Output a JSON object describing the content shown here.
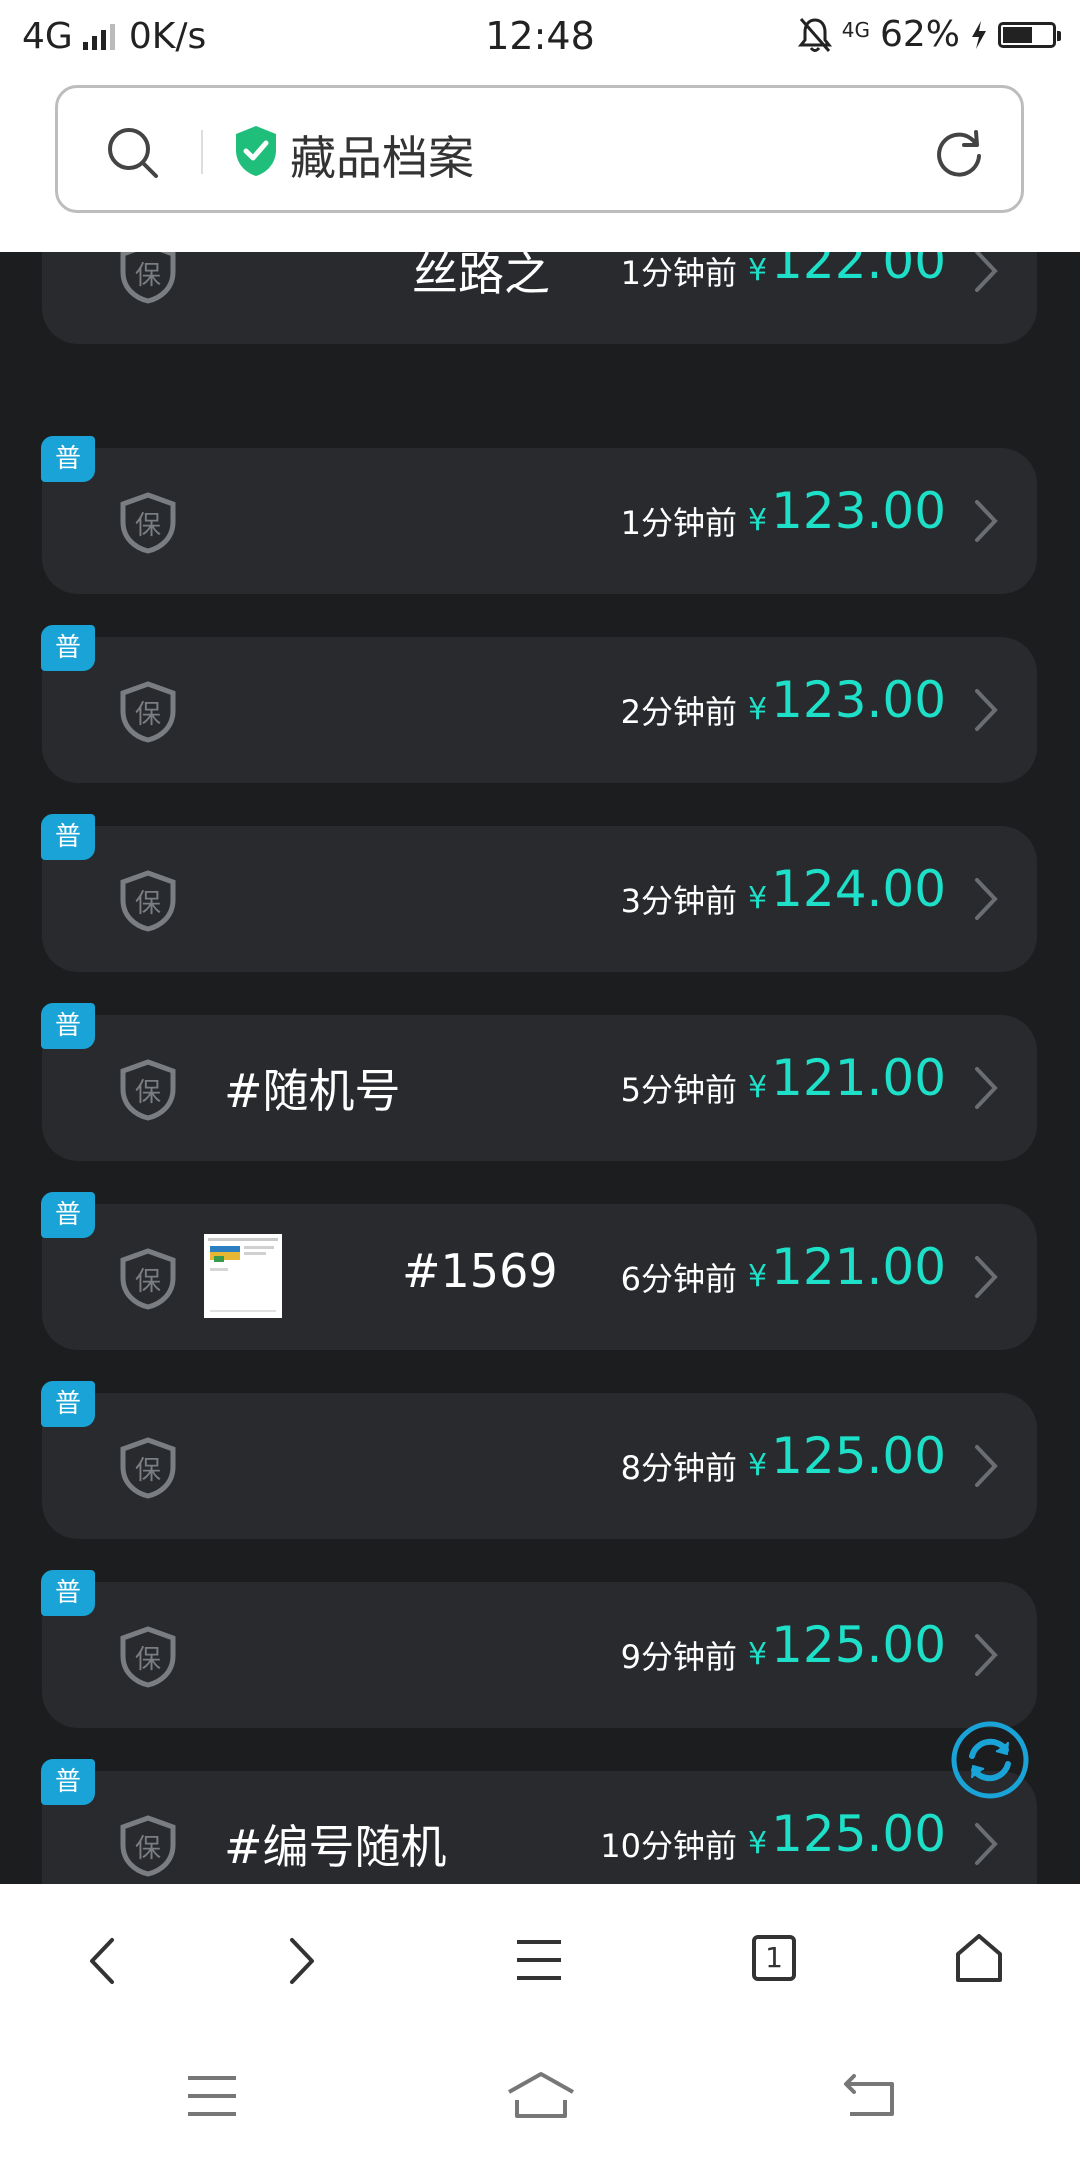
{
  "status_bar": {
    "network": "4G",
    "speed": "0K/s",
    "time": "12:48",
    "secondary_network": "4G",
    "battery": "62%",
    "battery_level": 0.62
  },
  "search_bar": {
    "title": "藏品档案"
  },
  "listings": [
    {
      "badge": "",
      "name": "丝路之",
      "time": "1分钟前",
      "currency": "¥",
      "price": "122.00"
    },
    {
      "badge": "普",
      "name": "",
      "time": "1分钟前",
      "currency": "¥",
      "price": "123.00"
    },
    {
      "badge": "普",
      "name": "",
      "time": "2分钟前",
      "currency": "¥",
      "price": "123.00"
    },
    {
      "badge": "普",
      "name": "",
      "time": "3分钟前",
      "currency": "¥",
      "price": "124.00"
    },
    {
      "badge": "普",
      "name": "#随机号",
      "time": "5分钟前",
      "currency": "¥",
      "price": "121.00"
    },
    {
      "badge": "普",
      "name": "#1569",
      "time": "6分钟前",
      "currency": "¥",
      "price": "121.00"
    },
    {
      "badge": "普",
      "name": "",
      "time": "8分钟前",
      "currency": "¥",
      "price": "125.00"
    },
    {
      "badge": "普",
      "name": "",
      "time": "9分钟前",
      "currency": "¥",
      "price": "125.00"
    },
    {
      "badge": "普",
      "name": "#编号随机",
      "time": "10分钟前",
      "currency": "¥",
      "price": "125.00"
    }
  ],
  "shield_char": "保",
  "tab_count": "1",
  "colors": {
    "accent": "#1ee0c8",
    "badge": "#1aa3d6",
    "card": "#282a2d",
    "background": "#1b1d1f"
  },
  "icons": [
    "search-icon",
    "verified-shield-icon",
    "refresh-icon",
    "shield-icon",
    "chevron-right-icon",
    "refresh-float-icon",
    "back-icon",
    "forward-icon",
    "menu-icon",
    "tabs-icon",
    "home-icon"
  ]
}
